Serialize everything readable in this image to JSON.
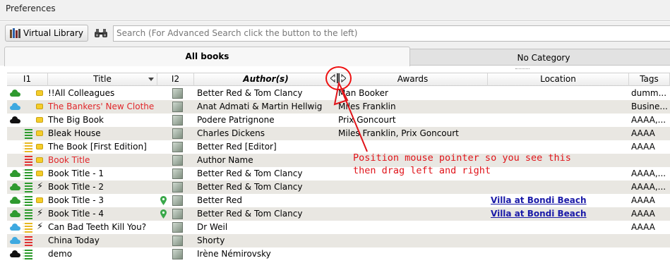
{
  "window": {
    "title": "Preferences"
  },
  "toolbar": {
    "virtual_library_label": "Virtual Library",
    "search_placeholder": "Search (For Advanced Search click the button to the left)"
  },
  "tabs": [
    {
      "label": "All books"
    },
    {
      "label": "No Category"
    }
  ],
  "columns": {
    "i1": "I1",
    "title": "Title",
    "i2": "I2",
    "author": "Author(s)",
    "awards": "Awards",
    "location": "Location",
    "tags": "Tags"
  },
  "colors": {
    "cloud_green": "#2f9a2f",
    "cloud_blue": "#3ea9e0",
    "cloud_black": "#111111",
    "list_green": "#2a9a2a",
    "list_yellow": "#e8b820",
    "list_red": "#e03030",
    "title_red": "#e0262a",
    "annotation": "#e0141a",
    "link": "#1a1aa8"
  },
  "rows": [
    {
      "cloud": "green",
      "list": "",
      "status": "yellow",
      "title": "!!All Colleagues",
      "title_red": false,
      "pin": false,
      "author": "Better Red & Tom Clancy",
      "awards": "Man Booker",
      "location": "",
      "tags": "dumm..."
    },
    {
      "cloud": "blue",
      "list": "",
      "status": "yellow",
      "title": "The Bankers' New Clothes",
      "title_red": true,
      "pin": false,
      "author": "Anat Admati & Martin Hellwig",
      "awards": "Miles Franklin",
      "location": "",
      "tags": "Busine..."
    },
    {
      "cloud": "black",
      "list": "",
      "status": "yellow",
      "title": "The Big Book",
      "title_red": false,
      "pin": false,
      "author": "Podere Patrignone",
      "awards": "Prix Goncourt",
      "location": "",
      "tags": "AAAA,..."
    },
    {
      "cloud": "",
      "list": "green",
      "status": "yellow",
      "title": "Bleak House",
      "title_red": false,
      "pin": false,
      "author": "Charles Dickens",
      "awards": "Miles Franklin, Prix Goncourt",
      "location": "",
      "tags": "AAAA"
    },
    {
      "cloud": "",
      "list": "yellow",
      "status": "yellow",
      "title": "The Book [First Edition]",
      "title_red": false,
      "pin": false,
      "author": "Better Red [Editor]",
      "awards": "",
      "location": "",
      "tags": "AAAA"
    },
    {
      "cloud": "",
      "list": "red",
      "status": "yellow",
      "title": "Book Title",
      "title_red": true,
      "pin": false,
      "author": "Author Name",
      "awards": "",
      "location": "",
      "tags": ""
    },
    {
      "cloud": "green",
      "list": "green",
      "status": "yellow",
      "title": "Book Title -  1",
      "title_red": false,
      "pin": false,
      "author": "Better Red & Tom Clancy",
      "awards": "",
      "location": "",
      "tags": "AAAA,..."
    },
    {
      "cloud": "green",
      "list": "green",
      "status": "bolt",
      "title": "Book Title -  2",
      "title_red": false,
      "pin": false,
      "author": "Better Red & Tom Clancy",
      "awards": "",
      "location": "",
      "tags": "AAAA,..."
    },
    {
      "cloud": "green",
      "list": "green",
      "status": "yellow",
      "title": "Book Title -  3",
      "title_red": false,
      "pin": true,
      "author": "Better Red",
      "awards": "",
      "location": "Villa at Bondi Beach",
      "tags": "AAAA"
    },
    {
      "cloud": "green",
      "list": "green",
      "status": "bolt",
      "title": "Book Title -  4",
      "title_red": false,
      "pin": true,
      "author": "Better Red & Tom Clancy",
      "awards": "",
      "location": "Villa at Bondi Beach",
      "tags": "AAAA"
    },
    {
      "cloud": "blue",
      "list": "yellow",
      "status": "bolt",
      "title": "Can Bad Teeth Kill You?",
      "title_red": false,
      "pin": false,
      "author": "Dr Weil",
      "awards": "",
      "location": "",
      "tags": "AAAA"
    },
    {
      "cloud": "blue",
      "list": "red",
      "status": "",
      "title": "China Today",
      "title_red": false,
      "pin": false,
      "author": "Shorty",
      "awards": "",
      "location": "",
      "tags": ""
    },
    {
      "cloud": "black",
      "list": "green",
      "status": "",
      "title": "demo",
      "title_red": false,
      "pin": false,
      "author": "Irène Némirovsky",
      "awards": "",
      "location": "",
      "tags": ""
    }
  ],
  "annotation": {
    "text": "Position mouse pointer so you see this\nthen drag left and right"
  }
}
